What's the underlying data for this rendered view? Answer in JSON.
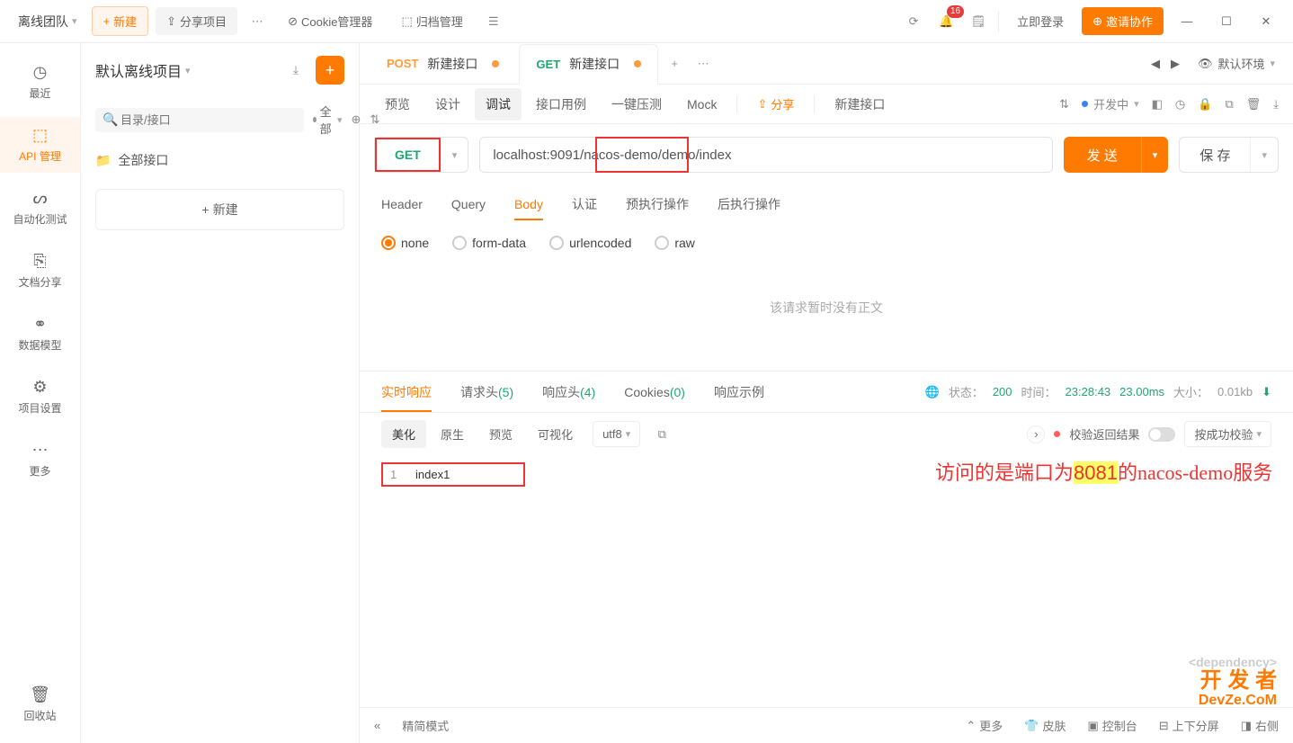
{
  "titlebar": {
    "team": "离线团队",
    "new_btn": "新建",
    "share_btn": "分享项目",
    "cookie_btn": "Cookie管理器",
    "archive_btn": "归档管理",
    "badge": "16",
    "login_btn": "立即登录",
    "invite_btn": "邀请协作"
  },
  "leftnav": {
    "recent": "最近",
    "api": "API 管理",
    "auto": "自动化测试",
    "docs": "文档分享",
    "data": "数据模型",
    "proj": "项目设置",
    "more": "更多",
    "trash": "回收站"
  },
  "sidebar": {
    "title": "默认离线项目",
    "search_ph": "目录/接口",
    "filter": "全部",
    "all_api": "全部接口",
    "new_btn": "新建"
  },
  "tabs": {
    "t1_method": "POST",
    "t1_name": "新建接口",
    "t2_method": "GET",
    "t2_name": "新建接口",
    "env_label": "默认环境"
  },
  "toolbar": {
    "preview": "预览",
    "design": "设计",
    "debug": "调试",
    "cases": "接口用例",
    "stress": "一键压测",
    "mock": "Mock",
    "share": "分享",
    "new_api": "新建接口",
    "status": "开发中"
  },
  "request": {
    "method": "GET",
    "url_pre": "localhost:9091/",
    "url_mid": "nacos-demo/",
    "url_post": "demo/index",
    "send": "发 送",
    "save": "保 存",
    "tabs": {
      "header": "Header",
      "query": "Query",
      "body": "Body",
      "auth": "认证",
      "pre": "预执行操作",
      "post": "后执行操作"
    },
    "body_opts": {
      "none": "none",
      "form": "form-data",
      "url": "urlencoded",
      "raw": "raw"
    },
    "empty": "该请求暂时没有正文"
  },
  "response": {
    "tabs": {
      "realtime": "实时响应",
      "req_head": "请求头",
      "req_head_n": "(5)",
      "resp_head": "响应头",
      "resp_head_n": "(4)",
      "cookies": "Cookies",
      "cookies_n": "(0)",
      "example": "响应示例"
    },
    "meta": {
      "status_lbl": "状态：",
      "status": "200",
      "time_lbl": "时间：",
      "time_a": "23:28:43",
      "time_b": "23.00ms",
      "size_lbl": "大小：",
      "size": "0.01kb"
    },
    "toolbar": {
      "pretty": "美化",
      "raw": "原生",
      "preview": "预览",
      "viz": "可视化",
      "enc": "utf8",
      "validate": "校验返回结果",
      "validate_btn": "按成功校验"
    },
    "body": {
      "line_no": "1",
      "line_txt": "index1"
    },
    "annotation": "访问的是端口为8081的nacos-demo服务",
    "annotation_hl": "8081"
  },
  "bottombar": {
    "mode": "精简模式",
    "more": "更多",
    "skin": "皮肤",
    "console": "控制台",
    "split": "上下分屏",
    "right": "右侧"
  }
}
